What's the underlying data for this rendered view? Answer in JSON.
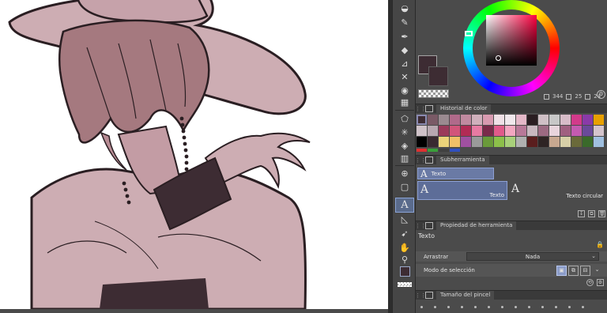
{
  "panels": {
    "color_history": {
      "title": "Historial de color"
    },
    "subtool": {
      "title": "Subherramienta",
      "group_label": "Texto",
      "items": [
        {
          "label": "Texto"
        },
        {
          "label": "Texto circular"
        }
      ]
    },
    "tool_property": {
      "title": "Propiedad de herramienta",
      "tool_name": "Texto",
      "drag_label": "Arrastrar",
      "drag_value": "Nada",
      "selection_mode_label": "Modo de selección"
    },
    "brush_size": {
      "title": "Tamaño del pincel"
    }
  },
  "color_wheel": {
    "h": "344",
    "s": "25",
    "v": "24",
    "main_color": "#3d2c33"
  },
  "history_colors": [
    "#3d2c33",
    "#7a5a66",
    "#9a8a90",
    "#b06a8a",
    "#c08aa0",
    "#d0b0bc",
    "#d89ab0",
    "#efe0e6",
    "#f0e8ec",
    "#e4b8c8",
    "#2a1e22",
    "#cfc0c6",
    "#c7c7c7",
    "#d7bcc8",
    "#d23a8a",
    "#8a3aa8",
    "#e8a000",
    "#cfc2c8",
    "#b8a8b0",
    "#9a3a5a",
    "#d2557a",
    "#b12b55",
    "#e87aa2",
    "#7a2a4a",
    "#e05a8a",
    "#f2a6c0",
    "#b87898",
    "#c8b8c0",
    "#9c6a82",
    "#e8d4dc",
    "#a06080",
    "#c45ab0",
    "#6a4a9a",
    "#d4c4cc",
    "#000000",
    "#3a2a30",
    "#ebd37a",
    "#f0c068",
    "#a050a0",
    "#9a9a9a",
    "#6a9a3a",
    "#8cc04a",
    "#a8d07a",
    "#b0b0b0",
    "#5a1e1e",
    "#2e2424",
    "#c8a890",
    "#d8d0a8",
    "#6a6a3a",
    "#3a6a2a",
    "#a0c0e0"
  ],
  "history_ticks": [
    "#e03030",
    "#3aa03a",
    "#404040",
    "#3050c0"
  ]
}
